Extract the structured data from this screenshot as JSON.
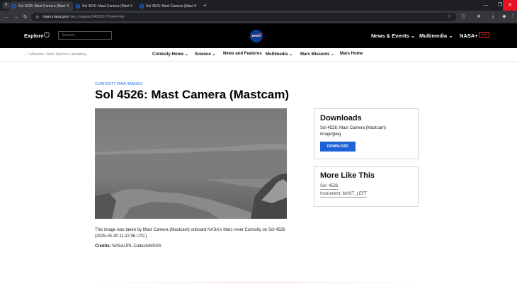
{
  "browser": {
    "tabs": [
      {
        "title": "Sol 4526: Mast Camera (Mastc"
      },
      {
        "title": "Sol 4526: Mast Camera (Mastc"
      },
      {
        "title": "Sol 4526: Mast Camera (Mastc"
      }
    ],
    "url_host": "mars.nasa.gov",
    "url_path": "/raw_images/1461337/?site=msl"
  },
  "header": {
    "explore": "Explore",
    "search_placeholder": "Search...",
    "nav": [
      "News & Events",
      "Multimedia",
      "NASA+"
    ],
    "live_badge": "LIVE"
  },
  "subnav": {
    "breadcrumb": "... / Missions / Mars Science Laboratory...",
    "items": [
      "Curiosity Home",
      "Science",
      "News and Features",
      "Multimedia",
      "Mars Missions",
      "Mars Home"
    ]
  },
  "main": {
    "eyebrow": "CURIOSITY RAW IMAGES",
    "title": "Sol 4526: Mast Camera (Mastcam)",
    "caption": "This image was taken by Mast Camera (Mastcam) onboard NASA's Mars rover Curiosity on Sol 4526 (2025-04-30 11:22:06 UTC).",
    "credits_label": "Credits:",
    "credits_value": " NASA/JPL-Caltech/MSSS"
  },
  "downloads": {
    "heading": "Downloads",
    "file_name": "Sol 4526: Mast Camera (Mastcam)",
    "file_type": "image/jpeg",
    "button": "DOWNLOAD"
  },
  "more": {
    "heading": "More Like This",
    "links": [
      "Sol: 4526",
      "Instrument: MAST_LEFT"
    ]
  },
  "colors": {
    "accent": "#1e62d8",
    "header_bg": "#000000",
    "live": "#e03030"
  }
}
